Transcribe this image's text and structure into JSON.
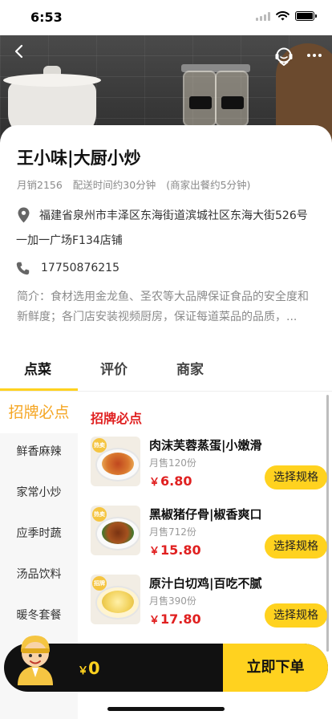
{
  "status_bar": {
    "time": "6:53"
  },
  "header": {
    "back_icon": "chevron-left-icon",
    "service_icon": "customer-service-icon",
    "more_icon": "more-dots-icon"
  },
  "shop": {
    "name": "王小味|大厨小炒",
    "monthly_sales": "月销2156",
    "delivery_time": "配送时间约30分钟",
    "prep_time": "(商家出餐约5分钟)",
    "address_line1": "福建省泉州市丰泽区东海街道滨城社区东海大街526号",
    "address_line2": "一加一广场F134店铺",
    "phone": "17750876215",
    "intro": "简介：食材选用金龙鱼、圣农等大品牌保证食品的安全度和新鲜度；各门店安装视频厨房，保证每道菜品的品质，..."
  },
  "tabs": [
    {
      "label": "点菜",
      "active": true
    },
    {
      "label": "评价",
      "active": false
    },
    {
      "label": "商家",
      "active": false
    }
  ],
  "categories": [
    {
      "label": "招牌必点",
      "active": true
    },
    {
      "label": "鲜香麻辣",
      "active": false
    },
    {
      "label": "家常小炒",
      "active": false
    },
    {
      "label": "应季时蔬",
      "active": false
    },
    {
      "label": "汤品饮料",
      "active": false
    },
    {
      "label": "暖冬套餐",
      "active": false
    }
  ],
  "section_title": "招牌必点",
  "products": [
    {
      "name": "肉沫芙蓉蒸蛋|小嫩滑",
      "sales": "月售120份",
      "currency": "￥",
      "price": "6.80",
      "button": "选择规格",
      "badge": "热卖"
    },
    {
      "name": "黑椒猪仔骨|椒香爽口",
      "sales": "月售712份",
      "currency": "￥",
      "price": "15.80",
      "button": "选择规格",
      "badge": "热卖"
    },
    {
      "name": "原汁白切鸡|百吃不腻",
      "sales": "月售390份",
      "currency": "￥",
      "price": "17.80",
      "button": "选择规格",
      "badge": "招牌"
    }
  ],
  "cart": {
    "currency": "￥",
    "amount": "0",
    "checkout_label": "立即下单"
  },
  "colors": {
    "accent": "#ffd21f",
    "price": "#e02020",
    "category_active": "#f5a623"
  }
}
